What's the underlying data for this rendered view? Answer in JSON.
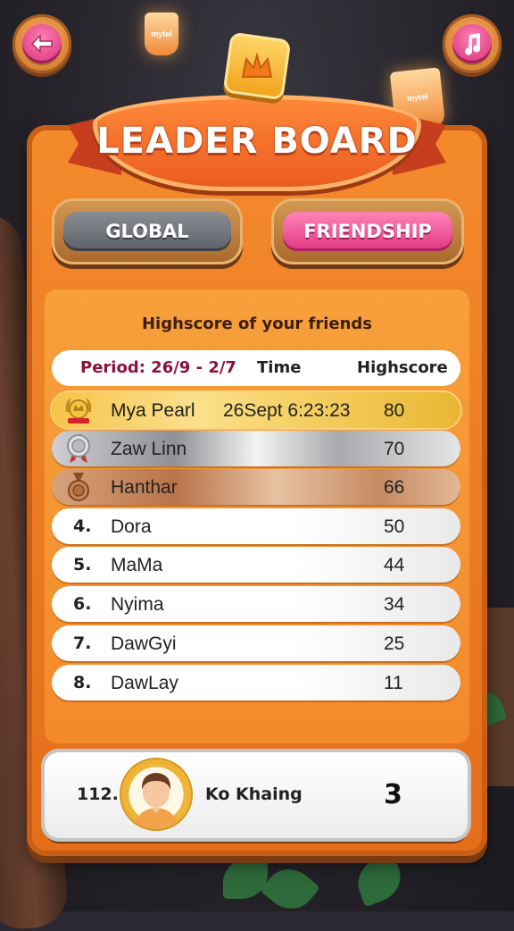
{
  "top_buttons": {
    "back_icon": "back-arrow-icon",
    "music_icon": "music-note-icon"
  },
  "decor": {
    "lantern_brand": "mytel"
  },
  "title": "LEADER BOARD",
  "tabs": [
    {
      "label": "GLOBAL",
      "active": false
    },
    {
      "label": "FRIENDSHIP",
      "active": true
    }
  ],
  "panel": {
    "heading": "Highscore of your friends",
    "columns": {
      "period": "Period: 26/9 - 2/7",
      "time": "Time",
      "highscore": "Highscore"
    },
    "rows": [
      {
        "rank": "",
        "medal": "gold-medal-icon",
        "name": "Mya Pearl",
        "time": "26Sept 6:23:23",
        "score": "80"
      },
      {
        "rank": "",
        "medal": "silver-medal-icon",
        "name": "Zaw Linn",
        "time": "",
        "score": "70"
      },
      {
        "rank": "",
        "medal": "bronze-medal-icon",
        "name": "Hanthar",
        "time": "",
        "score": "66"
      },
      {
        "rank": "4.",
        "name": "Dora",
        "time": "",
        "score": "50"
      },
      {
        "rank": "5.",
        "name": "MaMa",
        "time": "",
        "score": "44"
      },
      {
        "rank": "6.",
        "name": "Nyima",
        "time": "",
        "score": "34"
      },
      {
        "rank": "7.",
        "name": "DawGyi",
        "time": "",
        "score": "25"
      },
      {
        "rank": "8.",
        "name": "DawLay",
        "time": "",
        "score": "11"
      }
    ]
  },
  "current_user": {
    "rank": "112.",
    "name": "Ko Khaing",
    "score": "3"
  },
  "colors": {
    "accent_pink": "#e03782",
    "board_orange": "#f58a2d",
    "period_text": "#8c1238"
  }
}
